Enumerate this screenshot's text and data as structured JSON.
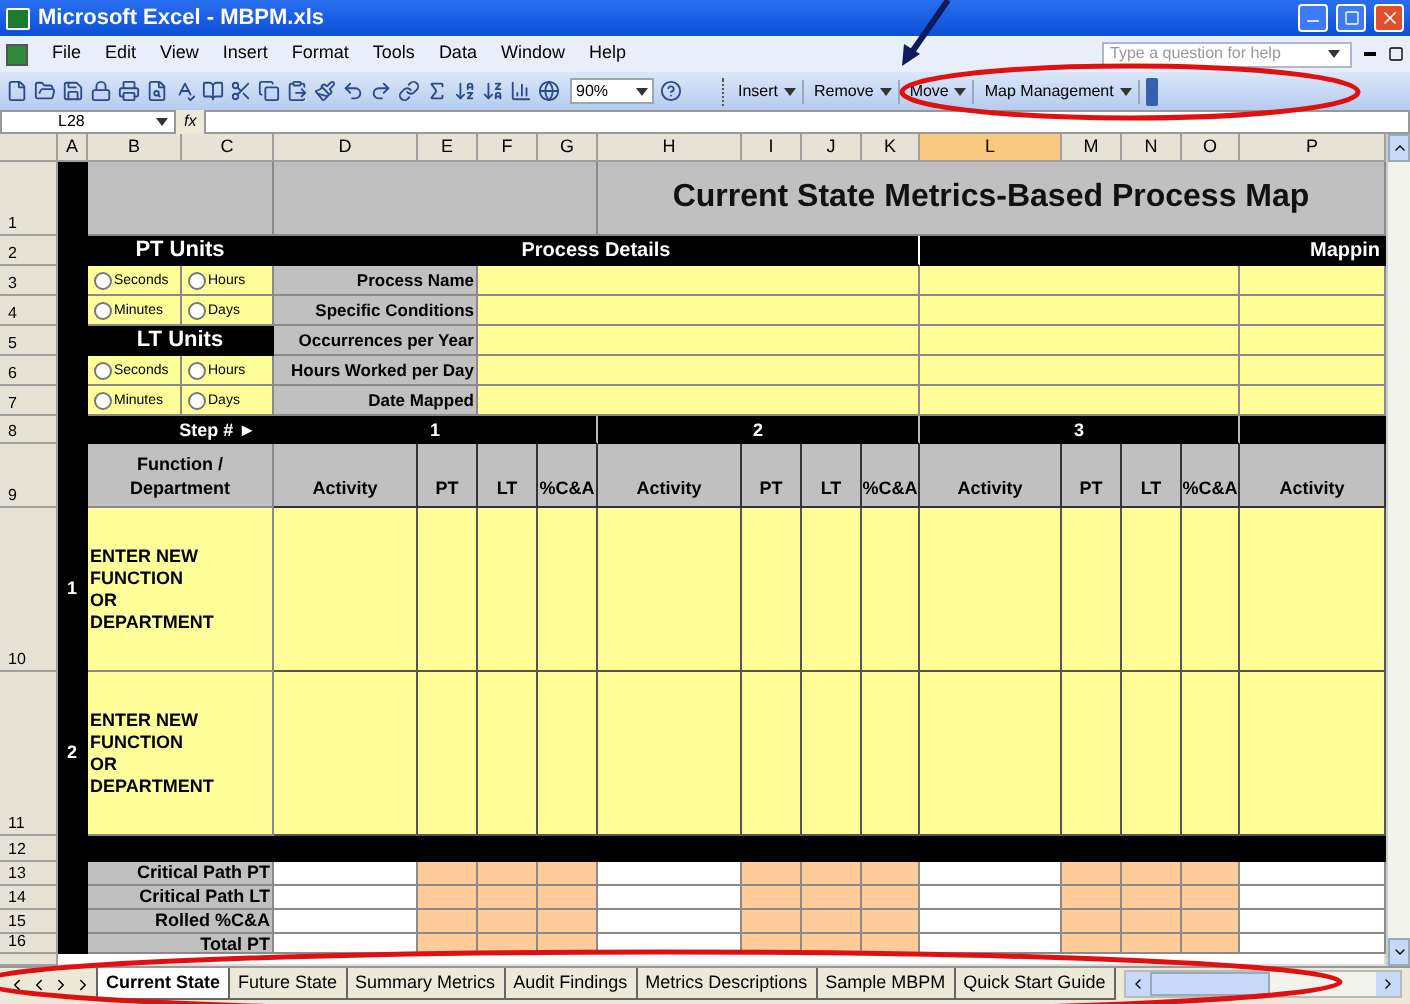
{
  "window": {
    "title": "Microsoft Excel - MBPM.xls"
  },
  "menu": [
    "File",
    "Edit",
    "View",
    "Insert",
    "Format",
    "Tools",
    "Data",
    "Window",
    "Help"
  ],
  "help_search": {
    "placeholder": "Type a question for help"
  },
  "zoom": "90%",
  "custom_toolbar": [
    "Insert",
    "Remove",
    "Move",
    "Map Management"
  ],
  "name_box": "L28",
  "formula_label": "fx",
  "column_headers": [
    {
      "label": "A",
      "selected": false
    },
    {
      "label": "B",
      "selected": false
    },
    {
      "label": "C",
      "selected": false
    },
    {
      "label": "D",
      "selected": false
    },
    {
      "label": "E",
      "selected": false
    },
    {
      "label": "F",
      "selected": false
    },
    {
      "label": "G",
      "selected": false
    },
    {
      "label": "H",
      "selected": false
    },
    {
      "label": "I",
      "selected": false
    },
    {
      "label": "J",
      "selected": false
    },
    {
      "label": "K",
      "selected": false
    },
    {
      "label": "L",
      "selected": true
    },
    {
      "label": "M",
      "selected": false
    },
    {
      "label": "N",
      "selected": false
    },
    {
      "label": "O",
      "selected": false
    },
    {
      "label": "P",
      "selected": false
    }
  ],
  "row_headers": [
    "1",
    "2",
    "3",
    "4",
    "5",
    "6",
    "7",
    "8",
    "9",
    "10",
    "11",
    "12",
    "13",
    "14",
    "15",
    "16"
  ],
  "sheet": {
    "title": "Current State Metrics-Based Process Map",
    "pt_units": {
      "title": "PT Units",
      "options": [
        {
          "label": "Seconds",
          "selected": false
        },
        {
          "label": "Hours",
          "selected": false
        },
        {
          "label": "Minutes",
          "selected": false
        },
        {
          "label": "Days",
          "selected": false
        }
      ]
    },
    "lt_units": {
      "title": "LT Units",
      "options": [
        {
          "label": "Seconds",
          "selected": false
        },
        {
          "label": "Hours",
          "selected": false
        },
        {
          "label": "Minutes",
          "selected": false
        },
        {
          "label": "Days",
          "selected": false
        }
      ]
    },
    "process_details_title": "Process Details",
    "mapping_title": "Mappin",
    "process_fields": [
      "Process Name",
      "Specific Conditions",
      "Occurrences per Year",
      "Hours Worked per Day",
      "Date Mapped"
    ],
    "step_label": "Step # ►",
    "steps": [
      "1",
      "2",
      "3"
    ],
    "function_header": "Function / Department",
    "column_labels": [
      "Activity",
      "PT",
      "LT",
      "%C&A",
      "Activity",
      "PT",
      "LT",
      "%C&A",
      "Activity",
      "PT",
      "LT",
      "%C&A",
      "Activity"
    ],
    "functions": [
      {
        "number": "1",
        "label": "ENTER NEW FUNCTION OR DEPARTMENT"
      },
      {
        "number": "2",
        "label": "ENTER NEW FUNCTION OR DEPARTMENT"
      }
    ],
    "totals": [
      "Critical Path PT",
      "Critical Path LT",
      "Rolled %C&A",
      "Total PT"
    ]
  },
  "sheet_tabs": [
    {
      "label": "Current State",
      "selected": true
    },
    {
      "label": "Future State",
      "selected": false
    },
    {
      "label": "Summary Metrics",
      "selected": false
    },
    {
      "label": "Audit Findings",
      "selected": false
    },
    {
      "label": "Metrics Descriptions",
      "selected": false
    },
    {
      "label": "Sample MBPM",
      "selected": false
    },
    {
      "label": "Quick Start Guide",
      "selected": false
    }
  ]
}
